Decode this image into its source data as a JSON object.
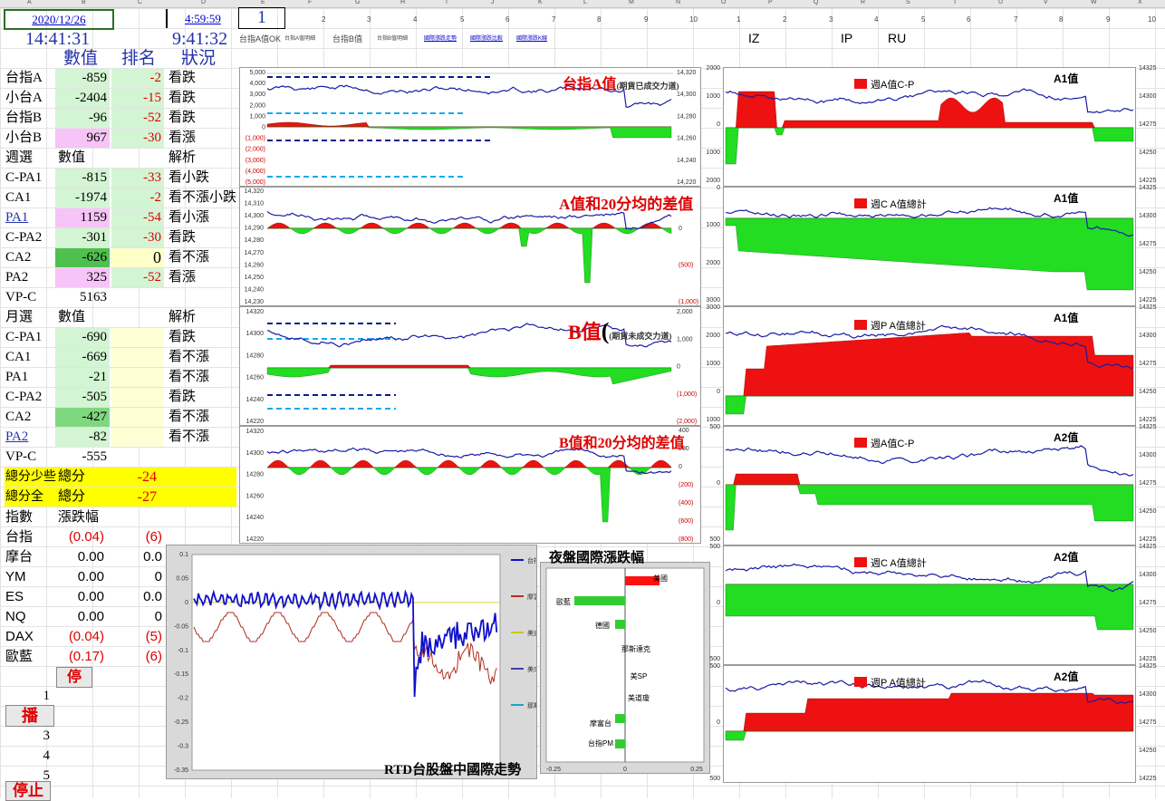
{
  "header": {
    "date": "2020/12/26",
    "time_a": "4:59:59",
    "selector": "1",
    "clock_left": "14:41:31",
    "clock_mid": "9:41:32",
    "col_labels": [
      "數值",
      "排名",
      "狀況"
    ],
    "tabs": [
      "台指A值OK",
      "台指A值明細",
      "台指B值",
      "台指B值明細",
      "國際漲跌走勢",
      "國際漲跌比較",
      "國際漲跌K線"
    ],
    "country_codes": [
      "IZ",
      "IP",
      "RU"
    ]
  },
  "col_letters": [
    "A",
    "B",
    "C",
    "D",
    "E",
    "F",
    "G",
    "H",
    "I",
    "J",
    "K",
    "L",
    "M",
    "N",
    "O",
    "P",
    "Q",
    "R",
    "S",
    "T",
    "U",
    "V",
    "W",
    "X"
  ],
  "num_row1": [
    "2",
    "3",
    "4",
    "5",
    "6",
    "7",
    "8",
    "9",
    "10"
  ],
  "num_row2": [
    "1",
    "2",
    "3",
    "4",
    "5",
    "6",
    "7",
    "8",
    "9",
    "10"
  ],
  "rows_index": [
    {
      "name": "台指A",
      "value": "-859",
      "rank": "-2",
      "status": "看跌"
    },
    {
      "name": "小台A",
      "value": "-2404",
      "rank": "-15",
      "status": "看跌"
    },
    {
      "name": "台指B",
      "value": "-96",
      "rank": "-52",
      "status": "看跌"
    },
    {
      "name": "小台B",
      "value": "967",
      "rank": "-30",
      "status": "看漲"
    }
  ],
  "weekly": {
    "header": [
      "週選",
      "數值",
      "解析"
    ],
    "rows": [
      {
        "name": "C-PA1",
        "value": "-815",
        "rank": "-33",
        "status": "看小跌"
      },
      {
        "name": "CA1",
        "value": "-1974",
        "rank": "-2",
        "status": "看不漲小跌"
      },
      {
        "name": "PA1",
        "value": "1159",
        "rank": "-54",
        "status": "看小漲"
      },
      {
        "name": "C-PA2",
        "value": "-301",
        "rank": "-30",
        "status": "看跌"
      },
      {
        "name": "CA2",
        "value": "-626",
        "rank": "0",
        "status": "看不漲"
      },
      {
        "name": "PA2",
        "value": "325",
        "rank": "-52",
        "status": "看漲"
      },
      {
        "name": "VP-C",
        "value": "5163",
        "rank": "",
        "status": ""
      }
    ]
  },
  "monthly": {
    "header": [
      "月選",
      "數值",
      "解析"
    ],
    "rows": [
      {
        "name": "C-PA1",
        "value": "-690",
        "status": "看跌"
      },
      {
        "name": "CA1",
        "value": "-669",
        "status": "看不漲"
      },
      {
        "name": "PA1",
        "value": "-21",
        "status": "看不漲"
      },
      {
        "name": "C-PA2",
        "value": "-505",
        "status": "看跌"
      },
      {
        "name": "CA2",
        "value": "-427",
        "status": "看不漲"
      },
      {
        "name": "PA2",
        "value": "-82",
        "status": "看不漲"
      },
      {
        "name": "VP-C",
        "value": "-555",
        "status": ""
      }
    ]
  },
  "totals": [
    {
      "name": "總分少些",
      "label": "總分",
      "value": "-24"
    },
    {
      "name": "總分全",
      "label": "總分",
      "value": "-27"
    }
  ],
  "intl": {
    "header": [
      "指數",
      "漲跌幅"
    ],
    "rows": [
      {
        "name": "台指",
        "pct": "(0.04)",
        "pts": "(6)"
      },
      {
        "name": "摩台",
        "pct": "0.00",
        "pts": "0.0"
      },
      {
        "name": "YM",
        "pct": "0.00",
        "pts": "0"
      },
      {
        "name": "ES",
        "pct": "0.00",
        "pts": "0.0"
      },
      {
        "name": "NQ",
        "pct": "0.00",
        "pts": "0"
      },
      {
        "name": "DAX",
        "pct": "(0.04)",
        "pts": "(5)"
      },
      {
        "name": "歐藍",
        "pct": "(0.17)",
        "pts": "(6)"
      }
    ]
  },
  "controls": {
    "stop": "停",
    "play": "播",
    "halt": "停止",
    "steps": [
      "1",
      "3",
      "4",
      "5"
    ]
  },
  "charts": {
    "a_value": {
      "title": "台指A值",
      "subtitle": "(期貨已成交力道)",
      "left_ticks": [
        "5,000",
        "4,000",
        "3,000",
        "2,000",
        "1,000",
        "0",
        "(1,000)",
        "(2,000)",
        "(3,000)",
        "(4,000)",
        "(5,000)"
      ],
      "right_ticks": [
        "14,320",
        "14,300",
        "14,280",
        "14,260",
        "14,240",
        "14,220"
      ]
    },
    "a_diff": {
      "title": "A值和20分均的差值",
      "left_ticks": [
        "14,320",
        "14,310",
        "14,300",
        "14,290",
        "14,280",
        "14,270",
        "14,260",
        "14,250",
        "14,240",
        "14,230"
      ],
      "right_ticks": [
        "0",
        "(500)",
        "(1,000)"
      ]
    },
    "b_value": {
      "title": "B值",
      "paren": "(",
      "subtitle": "(期貨未成交力道)",
      "left_ticks": [
        "14320",
        "14300",
        "14280",
        "14260",
        "14240",
        "14220"
      ],
      "right_ticks": [
        "2,000",
        "1,000",
        "0",
        "(1,000)",
        "(2,000)"
      ]
    },
    "b_diff": {
      "title": "B值和20分均的差值",
      "left_ticks": [
        "14320",
        "14300",
        "14280",
        "14260",
        "14240",
        "14220"
      ],
      "right_ticks": [
        "400",
        "200",
        "0",
        "(200)",
        "(400)",
        "(600)",
        "(800)"
      ]
    },
    "rtd": {
      "title": "RTD台股盤中國際走勢",
      "y_ticks": [
        "0.1",
        "0.05",
        "0",
        "-0.05",
        "-0.1",
        "-0.15",
        "-0.2",
        "-0.25",
        "-0.3",
        "-0.35"
      ],
      "legend": [
        "台指PM",
        "摩富台",
        "美道瓊",
        "美SP",
        "那斯達克"
      ]
    },
    "night": {
      "title": "夜盤國際漲跌幅",
      "labels": [
        "美國",
        "歐藍",
        "德國",
        "那斯達克",
        "美SP",
        "美道瓊",
        "摩富台",
        "台指PM"
      ],
      "x_ticks": [
        "-0.25",
        "0",
        "0.25"
      ]
    },
    "right": [
      {
        "header": "A1值",
        "legend": "週A值C-P",
        "left_ticks": [
          "2000",
          "1000",
          "0",
          "1000",
          "2000"
        ],
        "right_ticks": [
          "14325",
          "14300",
          "14275",
          "14250",
          "14225"
        ]
      },
      {
        "header": "A1值",
        "legend": "週C A值總計",
        "left_ticks": [
          "0",
          "1000",
          "2000",
          "3000"
        ],
        "right_ticks": [
          "14325",
          "14300",
          "14275",
          "14250",
          "14225"
        ]
      },
      {
        "header": "A1值",
        "legend": "週P A值總計",
        "left_ticks": [
          "3000",
          "2000",
          "1000",
          "0",
          "1000"
        ],
        "right_ticks": [
          "14325",
          "14300",
          "14275",
          "14250",
          "14225"
        ]
      },
      {
        "header": "A2值",
        "legend": "週A值C-P",
        "left_ticks": [
          "500",
          "0",
          "500"
        ],
        "right_ticks": [
          "14325",
          "14300",
          "14275",
          "14250",
          "14225"
        ]
      },
      {
        "header": "A2值",
        "legend": "週C A值總計",
        "left_ticks": [
          "500",
          "0",
          "500"
        ],
        "right_ticks": [
          "14325",
          "14300",
          "14275",
          "14250",
          "14225"
        ]
      },
      {
        "header": "A2值",
        "legend": "週P A值總計",
        "left_ticks": [
          "500",
          "0",
          "500"
        ],
        "right_ticks": [
          "14325",
          "14300",
          "14275",
          "14250",
          "14225"
        ]
      }
    ]
  }
}
